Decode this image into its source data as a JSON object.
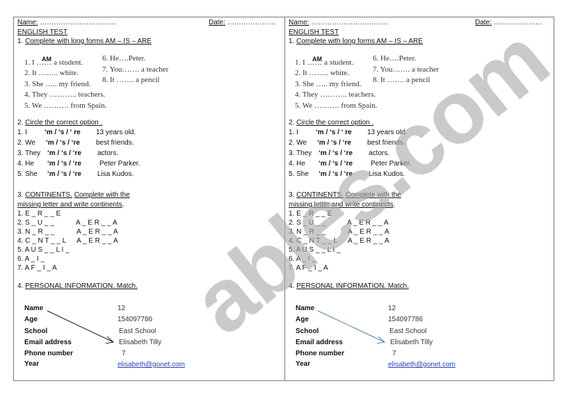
{
  "worksheet": {
    "name_label": "Name:",
    "name_dots": " ……………………………",
    "date_label": "Date:",
    "date_dots": " …………………",
    "title": "ENGLISH TEST",
    "section1": {
      "number": "1. ",
      "heading": "Complete with  long forms AM – IS – ARE",
      "answer_hint": "AM",
      "left_items": [
        "1. I   …… a student.",
        "2. It …….. white.",
        "3. She ….. my friend.",
        "4. They ……….. teachers.",
        "5. We ………. from Spain."
      ],
      "right_items": [
        "6. He….Peter.",
        "7. You……. a teacher",
        "8. It ……. a pencil"
      ]
    },
    "section2": {
      "number": "2. ",
      "heading": "Circle the correct option .",
      "rows": [
        {
          "subject": "1. I",
          "options": "‘m / ‘s / ‘ re",
          "rest": "13 years old."
        },
        {
          "subject": "2. We",
          "options": "‘m / ‘s / ‘re",
          "rest": "best friends."
        },
        {
          "subject": "3. They",
          "options": "‘m / ‘s / ‘re",
          "rest": "actors."
        },
        {
          "subject": "4. He",
          "options": "‘m / ‘s / ‘re",
          "rest": "Peter Parker."
        },
        {
          "subject": "5. She",
          "options": "‘m / ‘s / ‘re",
          "rest": "Lisa Kudos."
        }
      ]
    },
    "section3": {
      "number": "3. ",
      "heading_a": "CONTINENTS.",
      "heading_b": "Complete with the",
      "heading_c": "missing letter and write continents",
      "heading_end": ".",
      "items": [
        "1. E _ R _ _ E",
        "2. S _ U _ _",
        "3.  N _ R _ _",
        "4. C _ N T _ _ L",
        "5. A U S _ _ L I _",
        "6. A _ I _",
        "7. A F _ I _ A"
      ],
      "side_items": [
        "A _ E R _ _ A",
        "A _ E R _ _ A",
        "A _ E R _ _ A"
      ]
    },
    "section4": {
      "number": "4. ",
      "heading": "PERSONAL INFORMATION. Match.",
      "labels": [
        "Name",
        "Age",
        "School",
        "Email address",
        "Phone number",
        "Year"
      ],
      "values": [
        "12",
        "154097786",
        "East School",
        "Elisabeth Tilly",
        "7",
        "elisabeth@gonet.com"
      ]
    }
  },
  "arrow_colors": {
    "left": "#1a1a1a",
    "right": "#4f7fb3"
  },
  "watermark": "ables.com"
}
